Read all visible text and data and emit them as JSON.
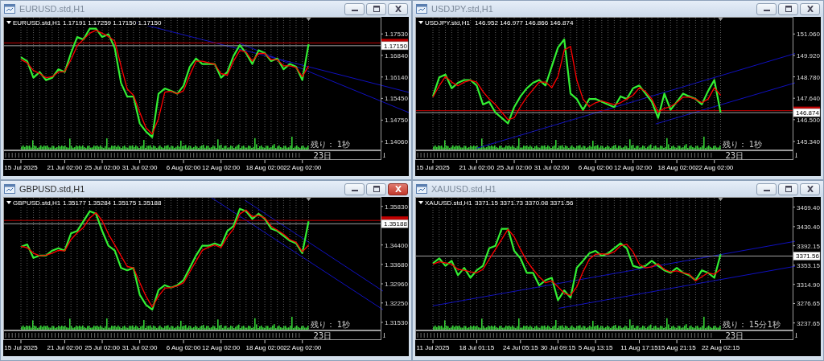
{
  "windows": [
    {
      "title": "EURUSD.std,H1",
      "active": false,
      "chart": {
        "symbol": "EURUSD.std,H1",
        "ohlc": "1.17191 1.17259 1.17150 1.17150",
        "countdown": "残り： 1秒",
        "strip_label": "23日",
        "chart_data": {
          "type": "line",
          "grid": true,
          "ylim": [
            1.138,
            1.1808
          ],
          "categories": [
            "15 Jul 2025",
            null,
            null,
            null,
            null,
            null,
            null,
            "21 Jul 02:00",
            null,
            null,
            null,
            null,
            null,
            "25 Jul 02:00",
            null,
            null,
            null,
            null,
            null,
            "31 Jul 02:00",
            null,
            null,
            null,
            null,
            null,
            null,
            "6 Aug 02:00",
            null,
            null,
            null,
            null,
            null,
            "12 Aug 02:00",
            null,
            null,
            null,
            null,
            null,
            null,
            "18 Aug 02:00",
            null,
            null,
            null,
            null,
            null,
            "22 Aug 02:00",
            null,
            null,
            null,
            null,
            null,
            null,
            null,
            null,
            null,
            null,
            null,
            null
          ],
          "yticks": [
            {
              "value": 1.1753,
              "label": "1.17530"
            },
            {
              "value": 1.1684,
              "label": "1.16840"
            },
            {
              "value": 1.1614,
              "label": "1.16140"
            },
            {
              "value": 1.1545,
              "label": "1.15450"
            },
            {
              "value": 1.1475,
              "label": "1.14750"
            },
            {
              "value": 1.1406,
              "label": "1.14060"
            }
          ],
          "series": [
            {
              "color": "#33ee33",
              "values": [
                1.1678,
                1.1665,
                1.1612,
                1.163,
                1.1604,
                1.1612,
                1.1639,
                1.163,
                1.1691,
                1.1743,
                1.1735,
                1.177,
                1.177,
                1.1743,
                1.1752,
                1.1708,
                1.1595,
                1.1551,
                1.1551,
                1.1464,
                1.1438,
                1.142,
                1.156,
                1.1577,
                1.1569,
                1.156,
                1.1586,
                1.1647,
                1.1674,
                1.1656,
                1.1656,
                1.1656,
                1.1612,
                1.163,
                1.1682,
                1.1717,
                1.1691,
                1.1656,
                1.17,
                1.1691,
                1.1665,
                1.1674,
                1.1639,
                1.1656,
                1.1647,
                1.1604,
                1.172,
                null,
                null,
                null,
                null,
                null,
                null,
                null,
                null,
                null,
                null,
                null
              ]
            },
            {
              "color": "#ff0000",
              "values": [
                1.167,
                1.166,
                1.1635,
                1.1625,
                1.1612,
                1.1615,
                1.163,
                1.1632,
                1.167,
                1.1715,
                1.1735,
                1.1755,
                1.1765,
                1.1755,
                1.1745,
                1.173,
                1.165,
                1.1575,
                1.1555,
                1.15,
                1.145,
                1.143,
                1.148,
                1.1565,
                1.1568,
                1.156,
                1.157,
                1.162,
                1.1665,
                1.1665,
                1.166,
                1.1655,
                1.1625,
                1.162,
                1.1665,
                1.17,
                1.1695,
                1.1665,
                1.169,
                1.169,
                1.167,
                1.167,
                1.165,
                1.165,
                1.1645,
                1.1615,
                1.165,
                null,
                null,
                null,
                null,
                null,
                null,
                null,
                null,
                null,
                null,
                null
              ]
            }
          ],
          "ref_lines": [
            {
              "axis": "y",
              "value": 1.1724,
              "color": "#c00000"
            },
            {
              "axis": "y",
              "value": 1.1715,
              "color": "#a0a0a0",
              "label": "1.17150"
            }
          ]
        }
      }
    },
    {
      "title": "USDJPY.std,H1",
      "active": false,
      "chart": {
        "symbol": "USDJPY.std,H1",
        "ohlc": "146.952 146.977 146.866 146.874",
        "countdown": "残り： 1秒",
        "strip_label": "23日",
        "chart_data": {
          "type": "line",
          "grid": true,
          "ylim": [
            144.91,
            151.97
          ],
          "categories": [
            "15 Jul 2025",
            null,
            null,
            null,
            null,
            null,
            null,
            "21 Jul 02:00",
            null,
            null,
            null,
            null,
            null,
            "25 Jul 02:00",
            null,
            null,
            null,
            null,
            null,
            "31 Jul 02:00",
            null,
            null,
            null,
            null,
            null,
            null,
            "6 Aug 02:00",
            null,
            null,
            null,
            null,
            null,
            "12 Aug 02:00",
            null,
            null,
            null,
            null,
            null,
            null,
            "18 Aug 02:00",
            null,
            null,
            null,
            null,
            null,
            "22 Aug 02:00",
            null,
            null,
            null,
            null,
            null,
            null,
            null,
            null,
            null,
            null,
            null,
            null
          ],
          "yticks": [
            {
              "value": 151.06,
              "label": "151.060"
            },
            {
              "value": 149.92,
              "label": "149.920"
            },
            {
              "value": 148.78,
              "label": "148.780"
            },
            {
              "value": 147.64,
              "label": "147.640"
            },
            {
              "value": 146.5,
              "label": "146.500"
            },
            {
              "value": 145.34,
              "label": "145.340"
            }
          ],
          "series": [
            {
              "color": "#33ee33",
              "values": [
                147.74,
                148.75,
                148.9,
                148.17,
                148.46,
                148.61,
                148.61,
                148.32,
                147.31,
                147.45,
                146.88,
                146.59,
                146.3,
                147.17,
                147.74,
                148.17,
                148.46,
                148.61,
                148.32,
                149.33,
                150.34,
                150.77,
                147.89,
                147.6,
                147.02,
                147.6,
                147.6,
                147.45,
                147.31,
                147.17,
                147.74,
                147.6,
                148.17,
                148.32,
                147.89,
                147.45,
                146.59,
                147.89,
                147.02,
                147.45,
                147.89,
                147.74,
                147.6,
                147.31,
                148.03,
                148.61,
                146.88,
                null,
                null,
                null,
                null,
                null,
                null,
                null,
                null,
                null,
                null,
                null
              ]
            },
            {
              "color": "#ff0000",
              "values": [
                147.7,
                148.3,
                148.8,
                148.5,
                148.3,
                148.5,
                148.6,
                148.5,
                148.0,
                147.6,
                147.3,
                146.9,
                146.5,
                146.6,
                147.2,
                147.7,
                148.1,
                148.5,
                148.5,
                148.2,
                148.8,
                150.2,
                150.4,
                148.6,
                147.6,
                147.2,
                147.4,
                147.5,
                147.4,
                147.3,
                147.4,
                147.6,
                147.8,
                148.2,
                148.0,
                147.6,
                146.9,
                147.1,
                147.2,
                147.4,
                147.7,
                147.7,
                147.6,
                147.4,
                147.6,
                148.2,
                147.8,
                null,
                null,
                null,
                null,
                null,
                null,
                null,
                null,
                null,
                null,
                null
              ]
            }
          ],
          "ref_lines": [
            {
              "axis": "y",
              "value": 146.98,
              "color": "#c00000"
            },
            {
              "axis": "y",
              "value": 146.874,
              "color": "#a0a0a0",
              "label": "146.874"
            }
          ]
        }
      }
    },
    {
      "title": "GBPUSD.std,H1",
      "active": true,
      "chart": {
        "symbol": "GBPUSD.std,H1",
        "ohlc": "1.35177 1.35284 1.35175 1.35188",
        "countdown": "残り： 1秒",
        "strip_label": "23日",
        "chart_data": {
          "type": "line",
          "grid": true,
          "ylim": [
            1.3126,
            1.3618
          ],
          "categories": [
            "15 Jul 2025",
            null,
            null,
            null,
            null,
            null,
            null,
            "21 Jul 02:00",
            null,
            null,
            null,
            null,
            null,
            "25 Jul 02:00",
            null,
            null,
            null,
            null,
            null,
            "31 Jul 02:00",
            null,
            null,
            null,
            null,
            null,
            null,
            "6 Aug 02:00",
            null,
            null,
            null,
            null,
            null,
            "12 Aug 02:00",
            null,
            null,
            null,
            null,
            null,
            null,
            "18 Aug 02:00",
            null,
            null,
            null,
            null,
            null,
            "22 Aug 02:00",
            null,
            null,
            null,
            null,
            null,
            null,
            null,
            null,
            null,
            null,
            null,
            null
          ],
          "yticks": [
            {
              "value": 1.3583,
              "label": "1.35830"
            },
            {
              "value": 1.344,
              "label": "1.34400"
            },
            {
              "value": 1.3368,
              "label": "1.33680"
            },
            {
              "value": 1.3296,
              "label": "1.32960"
            },
            {
              "value": 1.3225,
              "label": "1.32250"
            },
            {
              "value": 1.3153,
              "label": "1.31530"
            }
          ],
          "series": [
            {
              "color": "#33ee33",
              "values": [
                1.3433,
                1.3442,
                1.3392,
                1.3401,
                1.3401,
                1.3419,
                1.3428,
                1.3419,
                1.3483,
                1.3492,
                1.3528,
                1.3565,
                1.3556,
                1.3492,
                1.3437,
                1.3419,
                1.3355,
                1.3346,
                1.3355,
                1.3255,
                1.3218,
                1.32,
                1.3273,
                1.3291,
                1.3282,
                1.3291,
                1.331,
                1.3355,
                1.3401,
                1.3437,
                1.3437,
                1.3446,
                1.3437,
                1.3492,
                1.351,
                1.3574,
                1.3565,
                1.3537,
                1.3556,
                1.3537,
                1.3501,
                1.3492,
                1.3474,
                1.3456,
                1.3446,
                1.341,
                1.3528,
                null,
                null,
                null,
                null,
                null,
                null,
                null,
                null,
                null,
                null,
                null
              ]
            },
            {
              "color": "#ff0000",
              "values": [
                1.3435,
                1.343,
                1.341,
                1.34,
                1.3402,
                1.341,
                1.342,
                1.3418,
                1.346,
                1.3485,
                1.3505,
                1.354,
                1.356,
                1.353,
                1.348,
                1.344,
                1.34,
                1.336,
                1.3355,
                1.33,
                1.325,
                1.321,
                1.325,
                1.328,
                1.3282,
                1.3288,
                1.33,
                1.334,
                1.338,
                1.342,
                1.3432,
                1.344,
                1.343,
                1.347,
                1.35,
                1.3555,
                1.357,
                1.3545,
                1.355,
                1.354,
                1.351,
                1.3495,
                1.348,
                1.346,
                1.345,
                1.3415,
                1.344,
                null,
                null,
                null,
                null,
                null,
                null,
                null,
                null,
                null,
                null,
                null
              ]
            }
          ],
          "ref_lines": [
            {
              "axis": "y",
              "value": 1.3531,
              "color": "#c00000"
            },
            {
              "axis": "y",
              "value": 1.35188,
              "color": "#a0a0a0",
              "label": "1.35188"
            }
          ]
        }
      }
    },
    {
      "title": "XAUUSD.std,H1",
      "active": false,
      "chart": {
        "symbol": "XAUUSD.std,H1",
        "ohlc": "3371.15 3371.73 3370.08 3371.56",
        "countdown": "残り： 15分1秒",
        "strip_label": "23日",
        "chart_data": {
          "type": "line",
          "grid": true,
          "ylim": [
            3224.3,
            3489.7
          ],
          "categories": [
            "11 Jul 2025",
            null,
            null,
            null,
            null,
            null,
            null,
            "18 Jul 01:15",
            null,
            null,
            null,
            null,
            null,
            null,
            "24 Jul 05:15",
            null,
            null,
            null,
            null,
            null,
            "30 Jul 09:15",
            null,
            null,
            null,
            null,
            null,
            "5 Aug 13:15",
            null,
            null,
            null,
            null,
            null,
            null,
            "11 Aug 17:15",
            null,
            null,
            null,
            null,
            null,
            "15 Aug 21:15",
            null,
            null,
            null,
            null,
            null,
            null,
            "22 Aug 02:15",
            null,
            null,
            null,
            null,
            null,
            null,
            null,
            null,
            null,
            null,
            null
          ],
          "yticks": [
            {
              "value": 3469.4,
              "label": "3469.40"
            },
            {
              "value": 3430.4,
              "label": "3430.40"
            },
            {
              "value": 3392.15,
              "label": "3392.15"
            },
            {
              "value": 3353.15,
              "label": "3353.15"
            },
            {
              "value": 3314.9,
              "label": "3314.90"
            },
            {
              "value": 3276.65,
              "label": "3276.65"
            },
            {
              "value": 3237.65,
              "label": "3237.65"
            }
          ],
          "series": [
            {
              "color": "#33ee33",
              "values": [
                3357,
                3367,
                3352,
                3362,
                3333,
                3348,
                3328,
                3343,
                3352,
                3387,
                3392,
                3426,
                3426,
                3382,
                3367,
                3338,
                3338,
                3313,
                3323,
                3328,
                3283,
                3303,
                3288,
                3348,
                3362,
                3377,
                3382,
                3372,
                3377,
                3387,
                3397,
                3387,
                3352,
                3348,
                3352,
                3362,
                3352,
                3343,
                3338,
                3348,
                3338,
                3333,
                3323,
                3343,
                3338,
                3328,
                3375,
                null,
                null,
                null,
                null,
                null,
                null,
                null,
                null,
                null,
                null,
                null
              ]
            },
            {
              "color": "#ff0000",
              "values": [
                3355,
                3360,
                3358,
                3355,
                3345,
                3343,
                3340,
                3338,
                3345,
                3365,
                3385,
                3405,
                3425,
                3410,
                3385,
                3362,
                3345,
                3330,
                3318,
                3322,
                3310,
                3297,
                3293,
                3310,
                3340,
                3365,
                3375,
                3376,
                3375,
                3380,
                3392,
                3395,
                3380,
                3355,
                3348,
                3350,
                3356,
                3345,
                3340,
                3342,
                3338,
                3335,
                3322,
                3330,
                3338,
                3335,
                3345,
                null,
                null,
                null,
                null,
                null,
                null,
                null,
                null,
                null,
                null,
                null
              ]
            }
          ],
          "ref_lines": [
            {
              "axis": "y",
              "value": 3371.56,
              "color": "#a0a0a0",
              "label": "3371.56"
            }
          ]
        }
      }
    }
  ]
}
